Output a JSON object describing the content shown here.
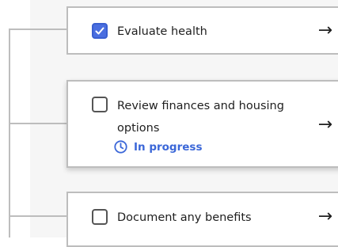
{
  "tasks": [
    {
      "label": "Evaluate health",
      "checked": true
    },
    {
      "label": "Review finances and housing options",
      "checked": false,
      "status": "In progress"
    },
    {
      "label": "Document any benefits",
      "checked": false
    }
  ],
  "arrow_glyph": "→",
  "colors": {
    "accent": "#3b67d8",
    "checked_fill": "#4a6ee0",
    "border": "#bdbdbd",
    "panel_background": "#f6f6f6"
  },
  "icons": {
    "checkbox_checked": "checkmark-icon",
    "status": "clock-icon",
    "navigate": "arrow-right-icon"
  }
}
